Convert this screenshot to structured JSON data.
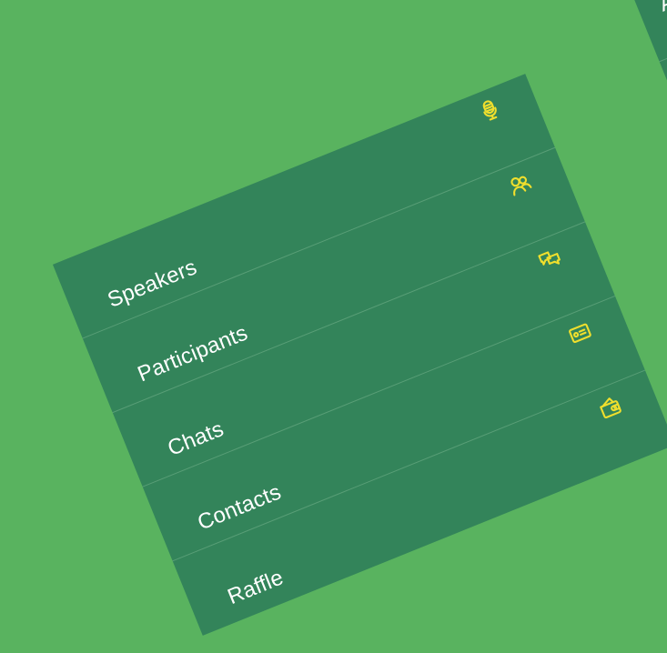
{
  "theme": {
    "background": "#59b35f",
    "panel": "#33845a",
    "icon": "#f0df2d",
    "text": "#ffffff"
  },
  "menu": {
    "items": [
      {
        "label": "Speakers",
        "icon": "microphone-icon"
      },
      {
        "label": "Participants",
        "icon": "people-icon"
      },
      {
        "label": "Chats",
        "icon": "chat-bubbles-icon"
      },
      {
        "label": "Contacts",
        "icon": "id-card-icon"
      },
      {
        "label": "Raffle",
        "icon": "wallet-icon"
      }
    ]
  },
  "secondary_panel": {
    "label": "Ab"
  }
}
